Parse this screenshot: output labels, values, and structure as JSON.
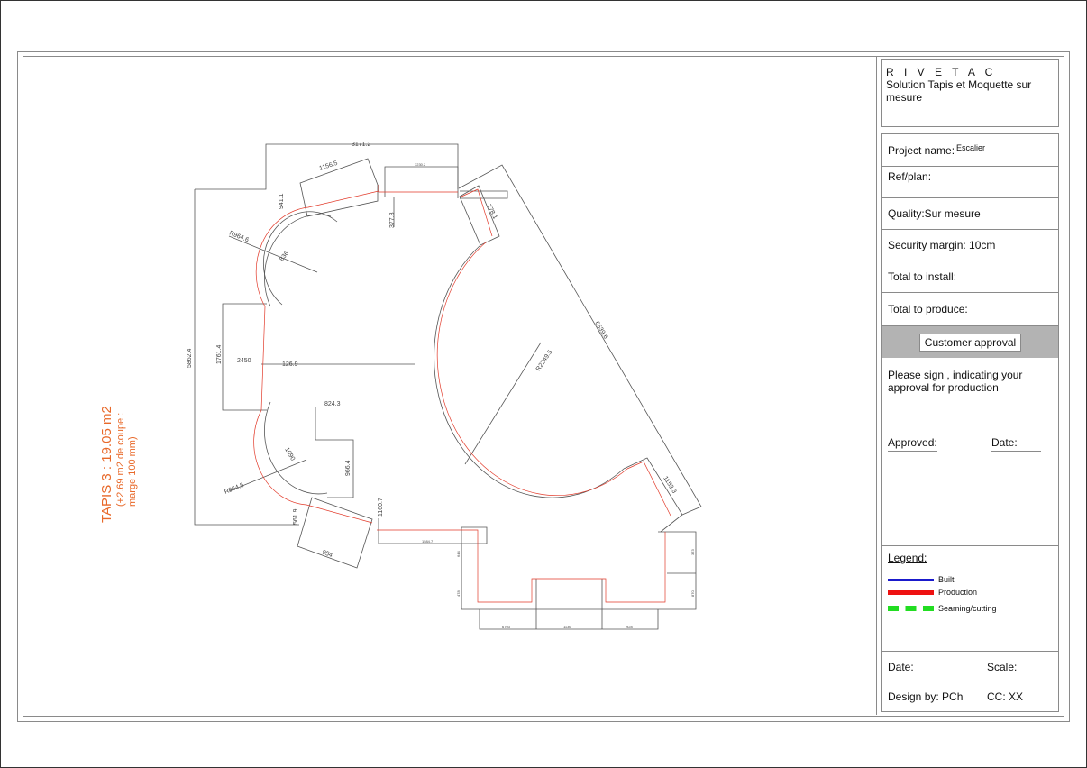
{
  "company": {
    "name": "R I V E T A C",
    "subtitle": "Solution Tapis et Moquette sur mesure"
  },
  "fields": {
    "project_label": "Project name:",
    "project_value": "Escalier",
    "ref_label": "Ref/plan:",
    "quality": "Quality:Sur mesure",
    "margin": "Security margin: 10cm",
    "install": "Total to install:",
    "produce": "Total to produce:"
  },
  "approval": {
    "button": "Customer  approval",
    "instruction": "Please sign , indicating your approval for production",
    "approved_label": "Approved:",
    "date_label": "Date:"
  },
  "legend": {
    "title": "Legend:",
    "items": [
      {
        "label": "Built",
        "color": "#1a1acc"
      },
      {
        "label": "Production",
        "color": "#ee1111"
      },
      {
        "label": "Seaming/cutting",
        "color": "#22dd22"
      }
    ]
  },
  "footer": {
    "date_label": "Date:",
    "scale_label": "Scale:",
    "design_label": "Design by: PCh",
    "cc_label": "CC:  XX"
  },
  "tapis": {
    "title": "TAPIS 3 : 19.05 m2",
    "line1": "(+2.69 m2 de coupe :",
    "line2": "marge 100 mm)",
    "color": "#e8692a"
  },
  "dimensions": {
    "d3171": "3171.2",
    "d1156": "1156.5",
    "d3230": "3230.2",
    "d941": "941.1",
    "d377": "377.8",
    "d778": "778.1",
    "dR964a": "R964.6",
    "d836": "836",
    "d5862": "5862.4",
    "d1761": "1761.4",
    "d2450": "2450",
    "d126": "126.9",
    "d6639": "6639.6",
    "dR2249": "R2249.5",
    "d824": "824.3",
    "d966": "966.4",
    "dR964b": "R964.5",
    "d1090": "1090",
    "d561": "561.9",
    "d1160": "1160.7",
    "d954": "954",
    "d1584": "1584.7",
    "d1153": "1153.3",
    "d644": "644",
    "d478": "478",
    "d870": "870",
    "d373": "373",
    "d6703": "6703",
    "d1136": "1136",
    "d928": "928"
  }
}
